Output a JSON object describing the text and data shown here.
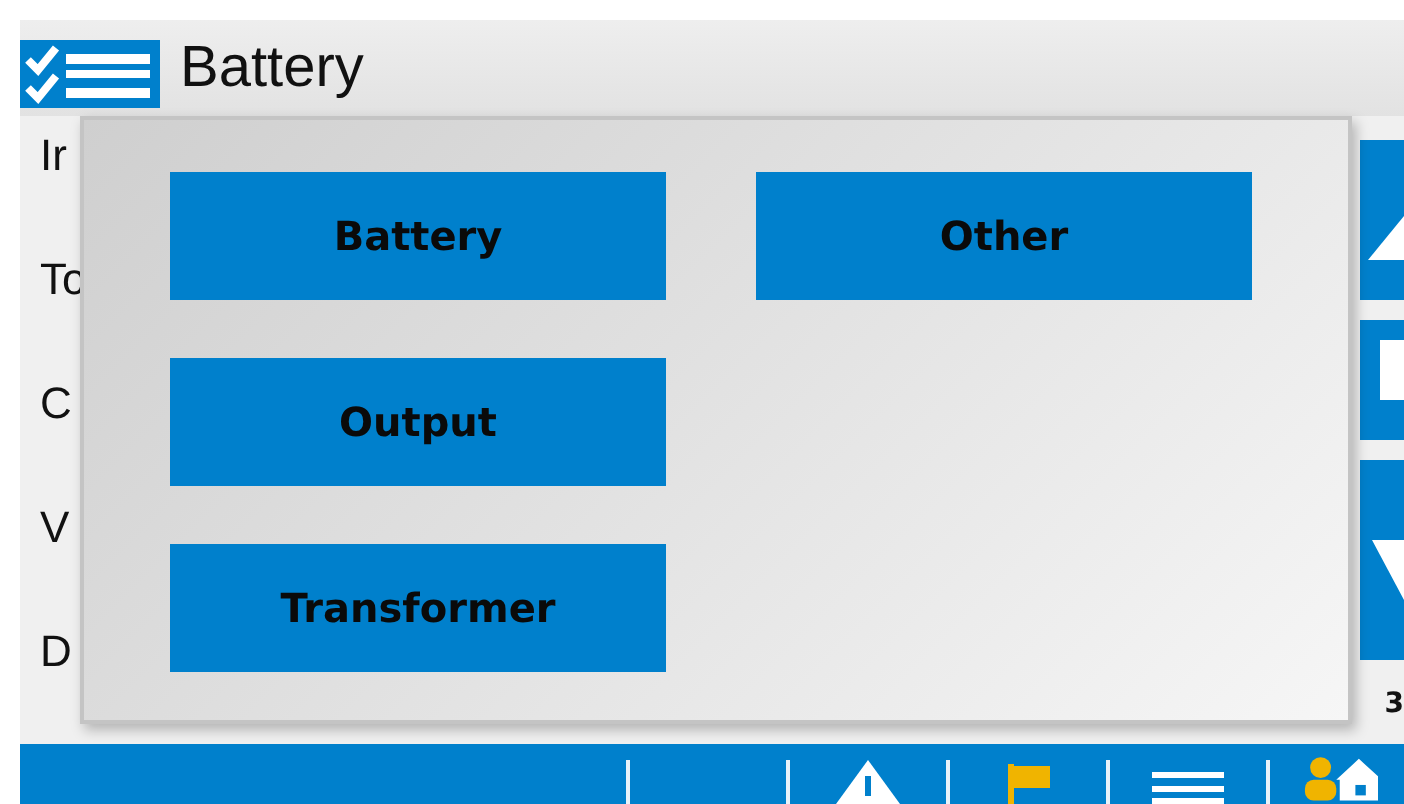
{
  "header": {
    "title": "Battery"
  },
  "list_items": [
    "Ir",
    "To",
    "C",
    "V",
    "D"
  ],
  "side_value": "3",
  "popup": {
    "rows": [
      {
        "buttons": [
          "Battery",
          "Other"
        ]
      },
      {
        "buttons": [
          "Output"
        ]
      },
      {
        "buttons": [
          "Transformer"
        ]
      }
    ]
  }
}
